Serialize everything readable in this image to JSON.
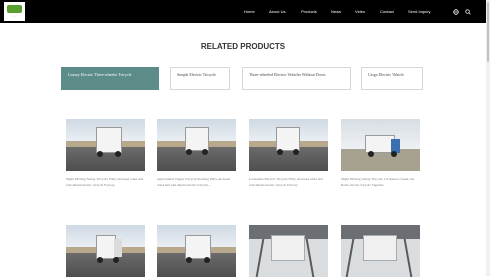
{
  "header": {
    "logo_text": "...",
    "nav": [
      "Home",
      "About Us",
      "Products",
      "News",
      "Video",
      "Contact",
      "Send Inquiry"
    ],
    "icons": [
      "globe-icon",
      "search-icon"
    ]
  },
  "section_title": "RELATED PRODUCTS",
  "tabs": [
    {
      "label": "Luxury Electric Three-wheeler Tricycle",
      "active": true
    },
    {
      "label": "Simple Electric Tricycle",
      "active": false
    },
    {
      "label": "Three-wheeled Electric Vehicles Without Doors",
      "active": false
    },
    {
      "label": "Cargo Electric Vehicle",
      "active": false
    }
  ],
  "products_row1": [
    {
      "caption": "Night Driving Safety Tricycle Fully enclosed wind and rain shield electric tricycle Factory"
    },
    {
      "caption": "Agricultural Tipper Tricycle Roofing Fully enclosed wind and rain shield electric tricycle..."
    },
    {
      "caption": "Lockeable Electric Tricycle Fully enclosed wind and rain shield electric tricycle Factory"
    },
    {
      "caption": "Night Driving Safety Tricycle 1.6 meters closed-cab Rolls electric tricycle Supplier"
    }
  ],
  "products_row2": [
    {
      "caption": ""
    },
    {
      "caption": ""
    },
    {
      "caption": ""
    },
    {
      "caption": ""
    }
  ],
  "colors": {
    "header_bg": "#000000",
    "active_tab": "#5c8c87",
    "logo_green": "#5a9e2f"
  }
}
